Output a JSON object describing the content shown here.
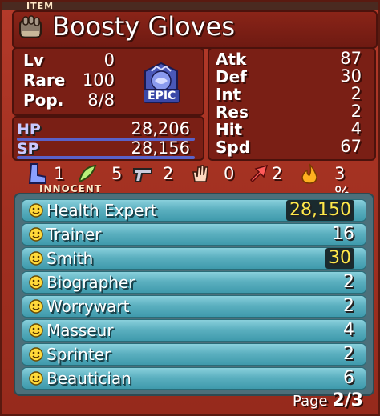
{
  "header": {
    "tag": "ITEM",
    "title": "Boosty Gloves"
  },
  "left_stats": [
    {
      "label": "Lv",
      "value": "0"
    },
    {
      "label": "Rare",
      "value": "100"
    },
    {
      "label": "Pop.",
      "value": "8/8"
    }
  ],
  "rarity_badge": {
    "label": "EPIC",
    "color": "#6a7de0"
  },
  "hp": {
    "label": "HP",
    "value": "28,206"
  },
  "sp": {
    "label": "SP",
    "value": "28,156"
  },
  "right_stats": [
    {
      "label": "Atk",
      "value": "87"
    },
    {
      "label": "Def",
      "value": "30"
    },
    {
      "label": "Int",
      "value": "2"
    },
    {
      "label": "Res",
      "value": "2"
    },
    {
      "label": "Hit",
      "value": "4"
    },
    {
      "label": "Spd",
      "value": "67"
    }
  ],
  "resistances": [
    {
      "icon": "boot-icon",
      "value": "1"
    },
    {
      "icon": "feather-icon",
      "value": "5"
    },
    {
      "icon": "gun-icon",
      "value": "2"
    },
    {
      "icon": "hand-icon",
      "value": "0"
    },
    {
      "icon": "arrow-icon",
      "value": "2"
    },
    {
      "icon": "fire-icon",
      "value": "3 %"
    }
  ],
  "innocent": {
    "tag": "INNOCENT",
    "rows": [
      {
        "name": "Health Expert",
        "level": "28,150",
        "highlight": true
      },
      {
        "name": "Trainer",
        "level": "16",
        "highlight": false
      },
      {
        "name": "Smith",
        "level": "30",
        "highlight": true
      },
      {
        "name": "Biographer",
        "level": "2",
        "highlight": false
      },
      {
        "name": "Worrywart",
        "level": "2",
        "highlight": false
      },
      {
        "name": "Masseur",
        "level": "4",
        "highlight": false
      },
      {
        "name": "Sprinter",
        "level": "2",
        "highlight": false
      },
      {
        "name": "Beautician",
        "level": "6",
        "highlight": false
      }
    ]
  },
  "pager": {
    "label": "Page",
    "value": "2/3"
  }
}
